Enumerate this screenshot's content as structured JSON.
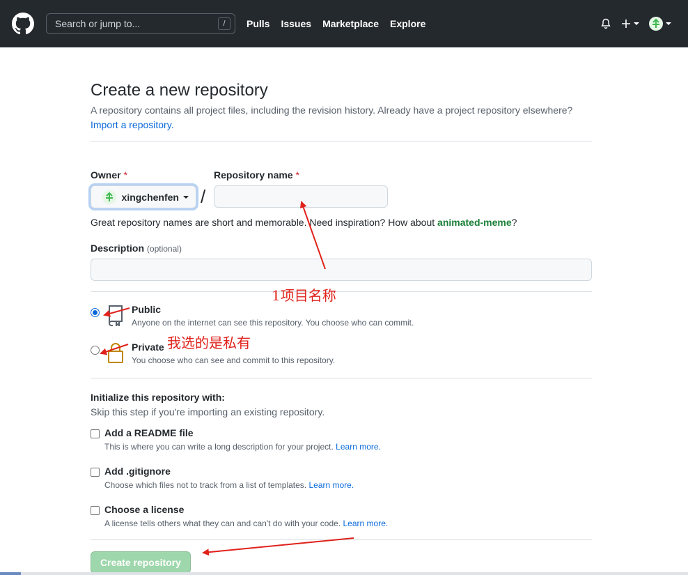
{
  "header": {
    "search_placeholder": "Search or jump to...",
    "search_shortcut": "/",
    "nav": [
      "Pulls",
      "Issues",
      "Marketplace",
      "Explore"
    ]
  },
  "page": {
    "title": "Create a new repository",
    "subtitle": "A repository contains all project files, including the revision history. Already have a project repository elsewhere?",
    "import_link": "Import a repository."
  },
  "form": {
    "owner_label": "Owner",
    "required_mark": "*",
    "owner_value": "xingchenfen",
    "separator": "/",
    "repo_name_label": "Repository name",
    "repo_name_value": "",
    "hint_prefix": "Great repository names are short and memorable. Need inspiration? How about",
    "hint_suggestion": "animated-meme",
    "hint_suffix": "?",
    "description_label": "Description",
    "description_optional": "(optional)",
    "description_value": ""
  },
  "visibility": {
    "public_title": "Public",
    "public_desc": "Anyone on the internet can see this repository. You choose who can commit.",
    "private_title": "Private",
    "private_desc": "You choose who can see and commit to this repository.",
    "selected": "public"
  },
  "initialize": {
    "title": "Initialize this repository with:",
    "subtitle": "Skip this step if you're importing an existing repository.",
    "learn_more": "Learn more.",
    "options": [
      {
        "title": "Add a README file",
        "desc": "This is where you can write a long description for your project.",
        "checked": false
      },
      {
        "title": "Add .gitignore",
        "desc": "Choose which files not to track from a list of templates.",
        "checked": false
      },
      {
        "title": "Choose a license",
        "desc": "A license tells others what they can and can't do with your code.",
        "checked": false
      }
    ]
  },
  "submit": {
    "label": "Create repository"
  },
  "annotations": {
    "repo_name_note": "1项目名称",
    "private_note": "我选的是私有",
    "color": "#e0221b"
  }
}
